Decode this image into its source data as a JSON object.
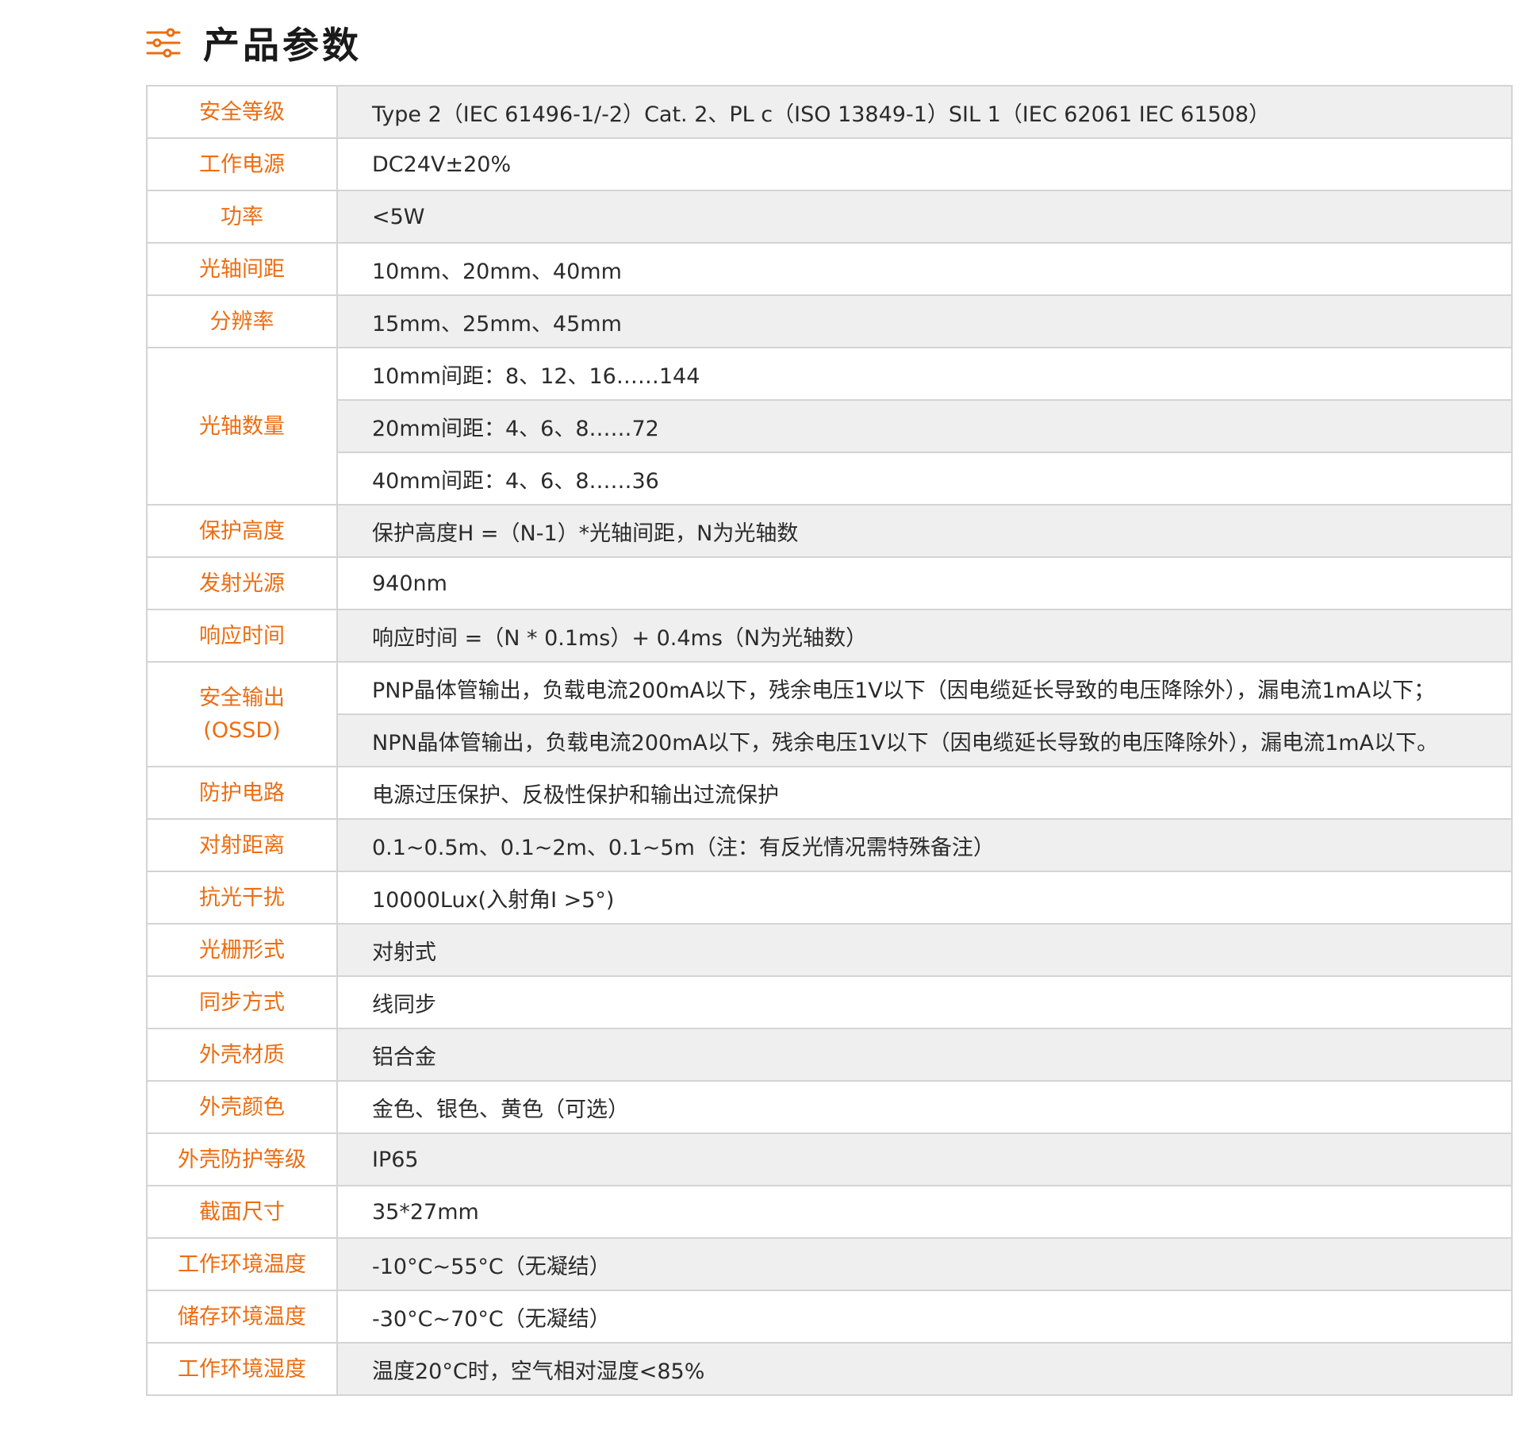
{
  "header": {
    "title": "产品参数",
    "icon": "sliders-icon",
    "accent_color": "#ec6d12"
  },
  "colors": {
    "label_text": "#ec6d12",
    "value_text": "#2b2b2b",
    "shaded_row": "#efefef",
    "border": "#d4d4d4"
  },
  "specs": [
    {
      "label": "安全等级",
      "values": [
        "Type 2（IEC 61496-1/-2）Cat. 2、PL c（ISO 13849-1）SIL 1（IEC 62061 IEC 61508）"
      ]
    },
    {
      "label": "工作电源",
      "values": [
        "DC24V±20%"
      ]
    },
    {
      "label": "功率",
      "values": [
        "<5W"
      ]
    },
    {
      "label": "光轴间距",
      "values": [
        "10mm、20mm、40mm"
      ]
    },
    {
      "label": "分辨率",
      "values": [
        "15mm、25mm、45mm"
      ]
    },
    {
      "label": "光轴数量",
      "values": [
        "10mm间距：8、12、16……144",
        "20mm间距：4、6、8……72",
        "40mm间距：4、6、8……36"
      ]
    },
    {
      "label": "保护高度",
      "values": [
        "保护高度H =（N-1）*光轴间距，N为光轴数"
      ]
    },
    {
      "label": "发射光源",
      "values": [
        "940nm"
      ]
    },
    {
      "label": "响应时间",
      "values": [
        "响应时间 =（N * 0.1ms）+ 0.4ms（N为光轴数）"
      ]
    },
    {
      "label": "安全输出",
      "label_line2": "(OSSD)",
      "values": [
        "PNP晶体管输出，负载电流200mA以下，残余电压1V以下（因电缆延长导致的电压降除外），漏电流1mA以下；",
        "NPN晶体管输出，负载电流200mA以下，残余电压1V以下（因电缆延长导致的电压降除外），漏电流1mA以下。"
      ]
    },
    {
      "label": "防护电路",
      "values": [
        "电源过压保护、反极性保护和输出过流保护"
      ]
    },
    {
      "label": "对射距离",
      "values": [
        "0.1~0.5m、0.1~2m、0.1~5m（注：有反光情况需特殊备注）"
      ]
    },
    {
      "label": "抗光干扰",
      "values": [
        "10000Lux(入射角I >5°)"
      ]
    },
    {
      "label": "光栅形式",
      "values": [
        "对射式"
      ]
    },
    {
      "label": "同步方式",
      "values": [
        "线同步"
      ]
    },
    {
      "label": "外壳材质",
      "values": [
        "铝合金"
      ]
    },
    {
      "label": "外壳颜色",
      "values": [
        "金色、银色、黄色（可选）"
      ]
    },
    {
      "label": "外壳防护等级",
      "values": [
        "IP65"
      ]
    },
    {
      "label": "截面尺寸",
      "values": [
        "35*27mm"
      ]
    },
    {
      "label": "工作环境温度",
      "values": [
        "-10°C~55°C（无凝结）"
      ]
    },
    {
      "label": "储存环境温度",
      "values": [
        "-30°C~70°C（无凝结）"
      ]
    },
    {
      "label": "工作环境湿度",
      "values": [
        "温度20°C时，空气相对湿度<85%"
      ]
    }
  ]
}
